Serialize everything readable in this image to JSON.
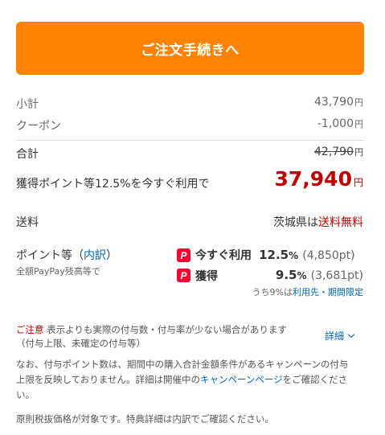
{
  "checkout_button": "ご注文手続きへ",
  "subtotal": {
    "label": "小計",
    "value": "43,790",
    "unit": "円"
  },
  "coupon": {
    "label": "クーポン",
    "value": "-1,000",
    "unit": "円"
  },
  "total": {
    "label": "合計",
    "value": "42,790",
    "unit": "円"
  },
  "discounted": {
    "label": "獲得ポイント等12.5%を今すぐ利用で",
    "value": "37,940",
    "unit": "円"
  },
  "shipping": {
    "label": "送料",
    "region": "茨城県は",
    "status": "送料無料"
  },
  "points": {
    "label": "ポイント等（",
    "link": "内訳",
    "label_end": "）",
    "sub": "全額PayPay残高等で",
    "immediate": {
      "title": "今すぐ利用",
      "rate": "12.5",
      "pct": "%",
      "amount": "(4,850pt)"
    },
    "earn": {
      "title": "獲得",
      "rate": "9.5",
      "pct": "%",
      "amount": "(3,681pt)"
    },
    "note_prefix": "うち9%は",
    "note_link": "利用先・期間限定"
  },
  "caution": {
    "label": "ご注意",
    "text": "表示よりも実際の付与数・付与率が少ない場合があります",
    "text2": "（付与上限、未確定の付与等）",
    "details": "詳細"
  },
  "note1": {
    "line1": "なお、付与ポイント数は、期間中の購入合計金額条件があるキャンペーンの付与",
    "line2a": "上限を反映しておりません。詳細は開催中の",
    "line2_link": "キャンペーンページ",
    "line2b": "をご確認くださ",
    "line3": "い。"
  },
  "note2": "原則税抜価格が対象です。特典詳細は内訳でご確認ください。",
  "paypay_icon": "P",
  "colors": {
    "accent": "#ff8200",
    "price_red": "#bf0000",
    "link": "#0068b7",
    "paypay": "#ff0033"
  }
}
